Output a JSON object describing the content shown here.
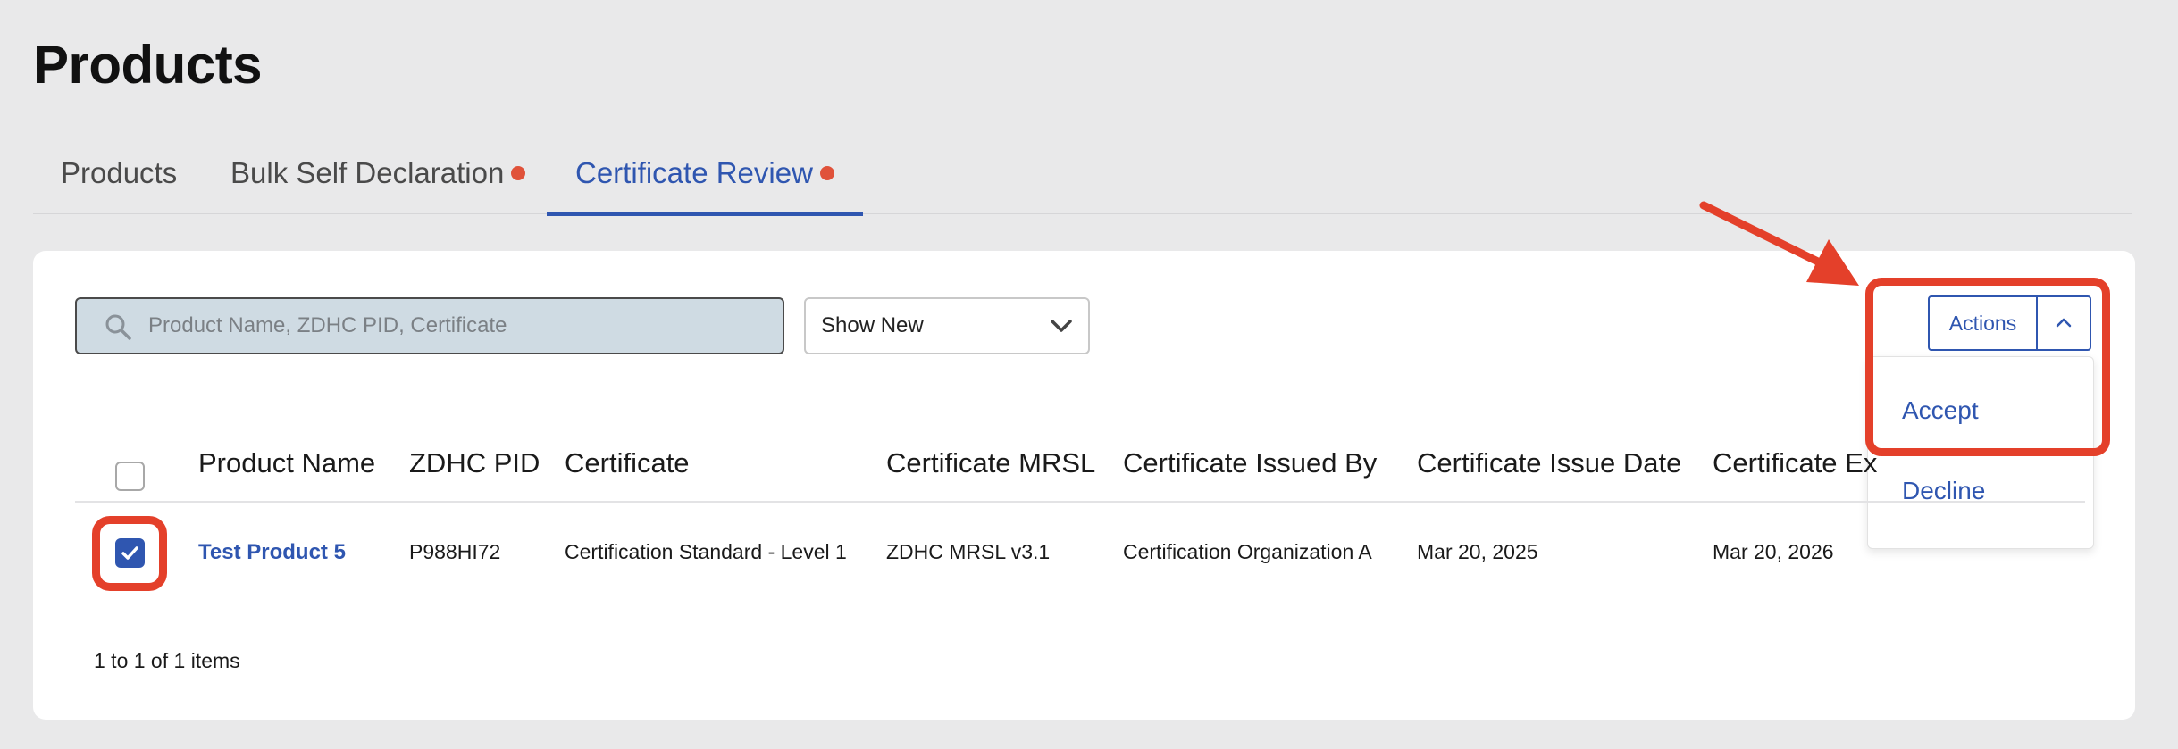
{
  "page": {
    "title": "Products"
  },
  "tabs": [
    {
      "label": "Products",
      "has_dot": false,
      "active": false
    },
    {
      "label": "Bulk Self Declaration",
      "has_dot": true,
      "active": false
    },
    {
      "label": "Certificate Review",
      "has_dot": true,
      "active": true
    }
  ],
  "toolbar": {
    "search": {
      "placeholder": "Product Name, ZDHC PID, Certificate",
      "value": ""
    },
    "filter": {
      "selected": "Show New"
    },
    "actions": {
      "label": "Actions",
      "menu": [
        "Accept",
        "Decline"
      ]
    }
  },
  "table": {
    "columns": [
      "Product Name",
      "ZDHC PID",
      "Certificate",
      "Certificate MRSL",
      "Certificate Issued By",
      "Certificate Issue Date",
      "Certificate Ex"
    ],
    "rows": [
      {
        "checked": true,
        "product_name": "Test Product 5",
        "zdhc_pid": "P988HI72",
        "certificate": "Certification Standard - Level 1",
        "certificate_mrsl": "ZDHC MRSL v3.1",
        "issued_by": "Certification Organization A",
        "issue_date": "Mar 20, 2025",
        "expiry": "Mar 20, 2026"
      }
    ]
  },
  "pagination": {
    "summary": "1 to 1 of 1 items"
  },
  "colors": {
    "accent": "#2f56b0",
    "tab_dot": "#e0523a",
    "annotation": "#e4402a",
    "background": "#e9e9ea",
    "search_bg": "#cfdbe3"
  }
}
